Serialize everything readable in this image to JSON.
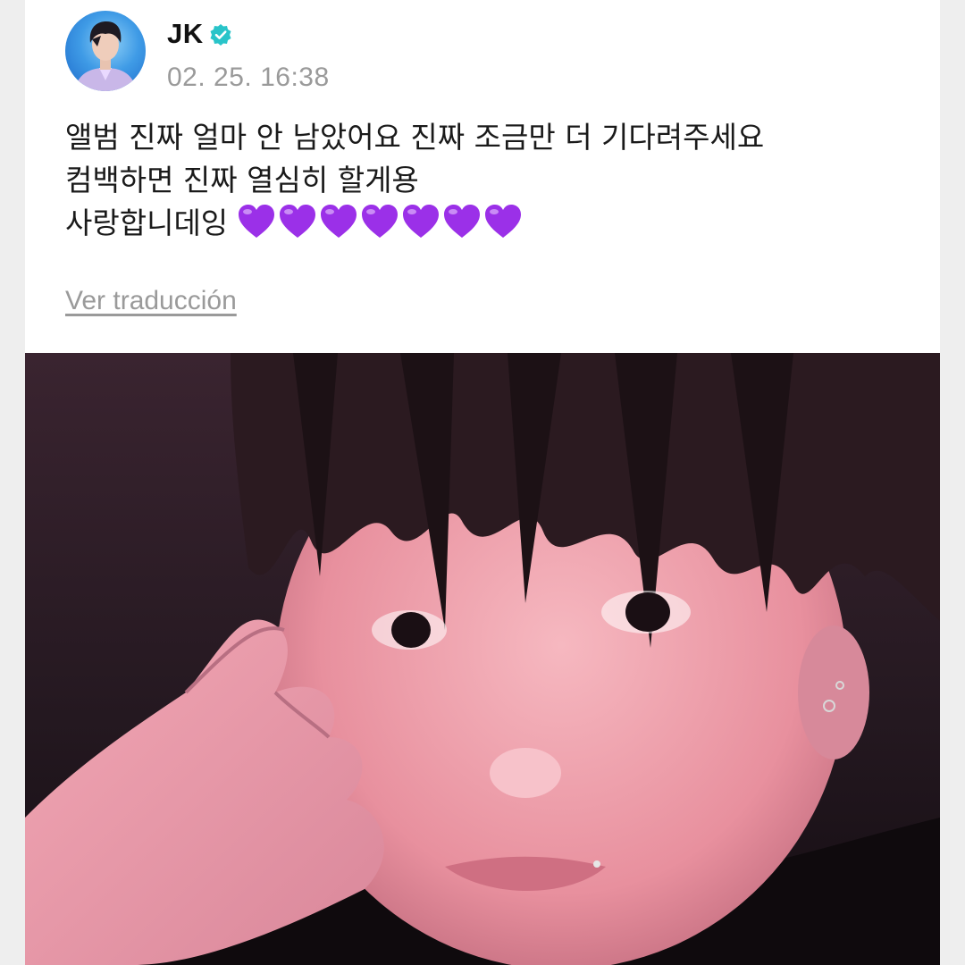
{
  "post": {
    "author": {
      "name": "JK",
      "verified": true,
      "verified_color": "#29c4c9"
    },
    "timestamp": "02. 25. 16:38",
    "lines": [
      "앨범 진짜 얼마 안 남았어요 진짜 조금만 더 기다려주세요",
      "컴백하면 진짜 열심히 할게용",
      "사랑합니데잉"
    ],
    "hearts": {
      "count": 7,
      "emoji": "purple-heart",
      "color": "#9b30e8"
    },
    "translate_label": "Ver traducción"
  },
  "icons": {
    "verified": "verified-badge-icon",
    "heart": "purple-heart-icon"
  }
}
